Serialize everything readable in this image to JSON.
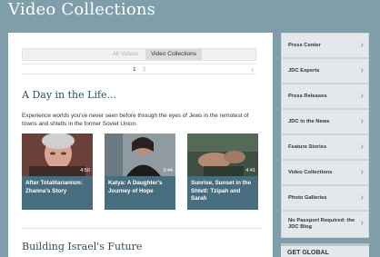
{
  "page": {
    "title": "Video Collections"
  },
  "tabs": [
    {
      "label": "All Videos",
      "active": false
    },
    {
      "label": "Video Collections",
      "active": true
    }
  ],
  "pager": {
    "pages": [
      "1",
      "2"
    ],
    "current": "1",
    "next_icon": "chevron-right-icon"
  },
  "section1": {
    "title": "A Day in the Life...",
    "intro": "Experience worlds you've never seen before through the eyes of Jews in the remotest of towns and shtetls in the former Soviet Union.",
    "videos": [
      {
        "title": "After Totalitarianism: Zhanna's Story",
        "duration": "4:50"
      },
      {
        "title": "Katya: A Daughter's Journey of Hope",
        "duration": "3:44"
      },
      {
        "title": "Sunrise, Sunset in the Shtetl: Tzipah and Sarah",
        "duration": "4:41"
      }
    ]
  },
  "section2": {
    "title": "Building Israel's Future"
  },
  "sidebar": {
    "items": [
      {
        "label": "Press Center"
      },
      {
        "label": "JDC Experts"
      },
      {
        "label": "Press Releases"
      },
      {
        "label": "JDC in the News"
      },
      {
        "label": "Feature Stories"
      },
      {
        "label": "Video Collections"
      },
      {
        "label": "Photo Galleries"
      },
      {
        "label": "No Passport Required: the JDC Blog"
      }
    ],
    "chevron_icon": "chevron-right-icon"
  },
  "get_global": {
    "label": "GET GLOBAL"
  },
  "colors": {
    "background": "#7f9eaa",
    "caption": "#486d7e",
    "heading": "#2f4f5e",
    "sidebar_item": "#e4e8ea"
  }
}
